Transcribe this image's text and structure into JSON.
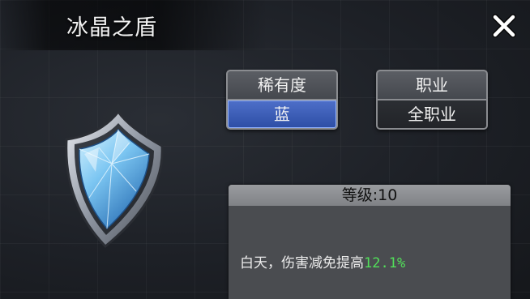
{
  "item": {
    "name": "冰晶之盾",
    "icon": "ice-crystal-shield"
  },
  "close": {
    "icon": "close-icon"
  },
  "rarity": {
    "label": "稀有度",
    "value": "蓝",
    "color": "#3a5cb8"
  },
  "profession": {
    "label": "职业",
    "value": "全职业"
  },
  "details": {
    "level_label": "等级:10",
    "effect_prefix": "白天，伤害减免提高",
    "effect_value": "12.1",
    "effect_suffix": "%",
    "highlight_color": "#52e05a"
  }
}
